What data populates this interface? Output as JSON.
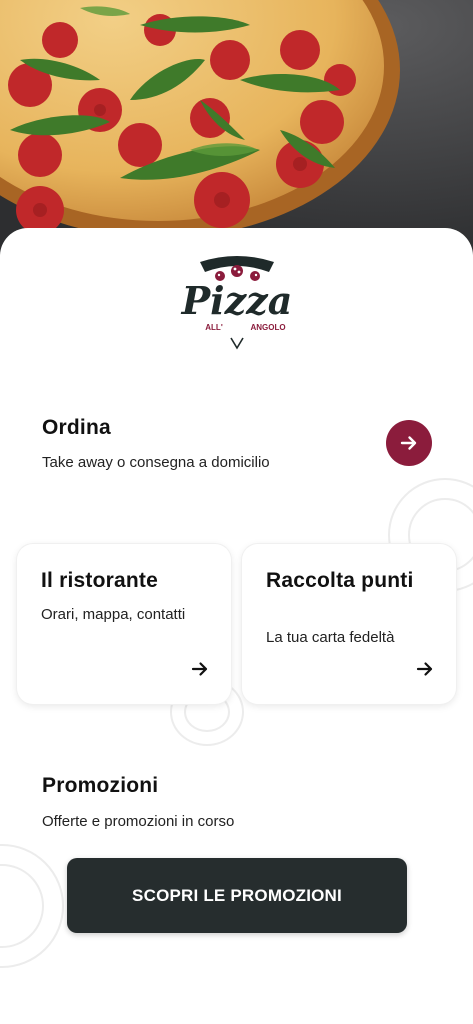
{
  "logo": {
    "wordmark": "Pizza",
    "tagline_left": "ALL'",
    "tagline_right": "ANGOLO"
  },
  "order": {
    "title": "Ordina",
    "subtitle": "Take away o consegna a domicilio",
    "button_icon": "arrow-right-icon"
  },
  "cards": [
    {
      "title": "Il ristorante",
      "subtitle": "Orari, mappa, contatti",
      "icon": "arrow-right-icon"
    },
    {
      "title": "Raccolta punti",
      "subtitle": "La tua carta fedeltà",
      "icon": "arrow-right-icon"
    }
  ],
  "promotions": {
    "title": "Promozioni",
    "subtitle": "Offerte e promozioni in corso",
    "button_label": "SCOPRI LE PROMOZIONI"
  },
  "colors": {
    "accent": "#8b1c3c",
    "dark_button": "#262d2e",
    "background": "#ffffff"
  }
}
